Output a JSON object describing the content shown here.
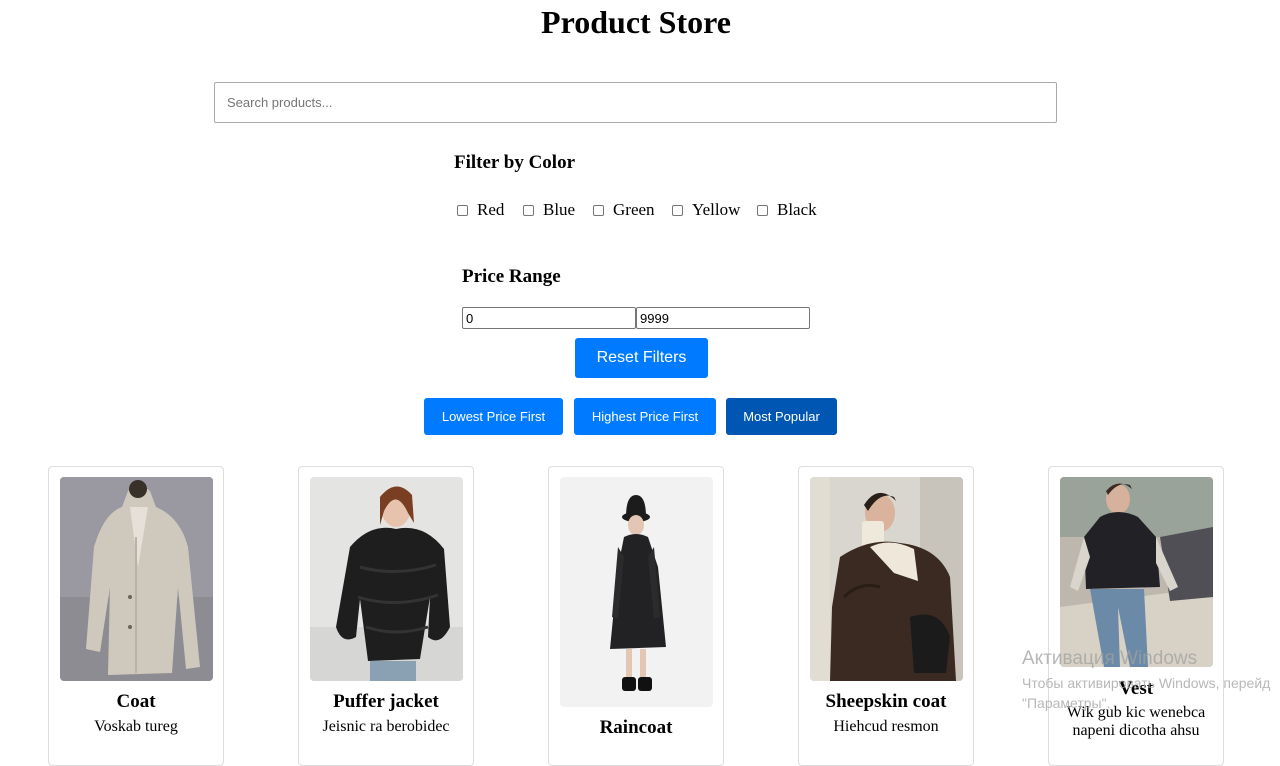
{
  "page": {
    "title": "Product Store"
  },
  "search": {
    "placeholder": "Search products...",
    "value": ""
  },
  "color_filter": {
    "heading": "Filter by Color",
    "options": [
      {
        "label": "Red",
        "checked": false
      },
      {
        "label": "Blue",
        "checked": false
      },
      {
        "label": "Green",
        "checked": false
      },
      {
        "label": "Yellow",
        "checked": false
      },
      {
        "label": "Black",
        "checked": false
      }
    ]
  },
  "price_range": {
    "heading": "Price Range",
    "min": "0",
    "max": "9999"
  },
  "buttons": {
    "reset": "Reset Filters",
    "sort_low": "Lowest Price First",
    "sort_high": "Highest Price First",
    "sort_popular": "Most Popular",
    "active_sort": "sort_popular"
  },
  "products": [
    {
      "name": "Coat",
      "desc": "Voskab tureg",
      "image": "coat-photo"
    },
    {
      "name": "Puffer jacket",
      "desc": "Jeisnic ra berobidec",
      "image": "puffer-jacket-photo"
    },
    {
      "name": "Raincoat",
      "desc": "",
      "image": "raincoat-photo"
    },
    {
      "name": "Sheepskin coat",
      "desc": "Hiehcud resmon",
      "image": "sheepskin-coat-photo"
    },
    {
      "name": "Vest",
      "desc": "Wik gub kic wenebca napeni dicotha ahsu",
      "image": "vest-photo"
    }
  ],
  "windows_watermark": {
    "line1": "Активация Windows",
    "line2": "Чтобы активировать Windows, перейд",
    "line3": "\"Параметры\"."
  },
  "colors": {
    "primary": "#007bff",
    "primary_active": "#0056b3",
    "border": "#dddddd"
  }
}
